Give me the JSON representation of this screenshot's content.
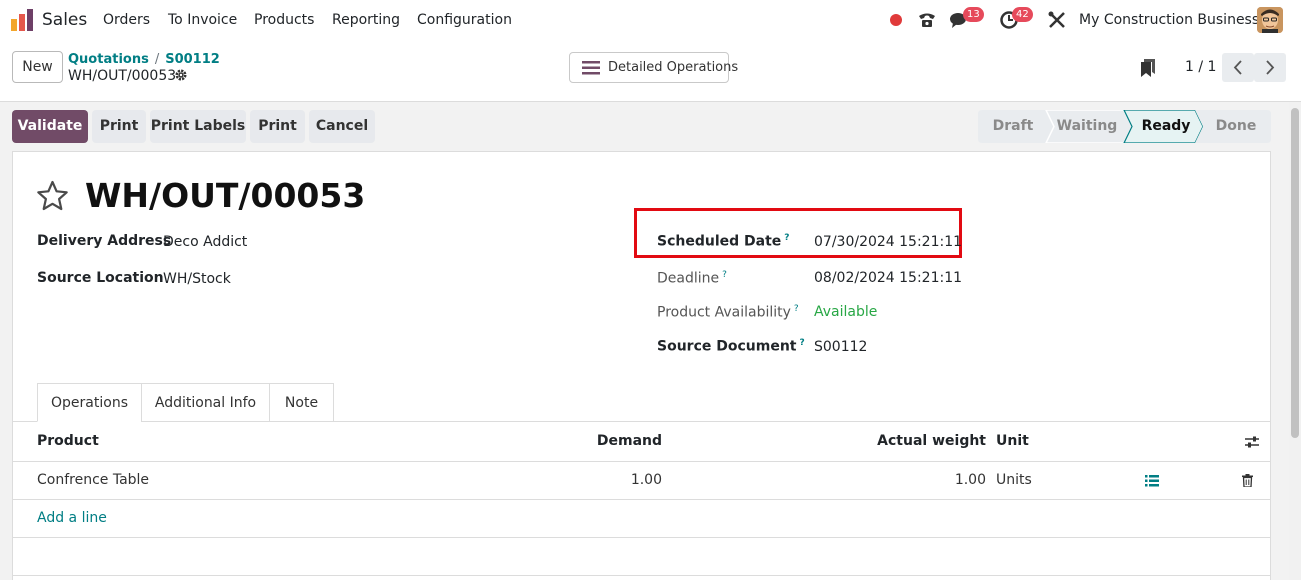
{
  "navbar": {
    "app_name": "Sales",
    "menu": [
      "Orders",
      "To Invoice",
      "Products",
      "Reporting",
      "Configuration"
    ],
    "chat_badge": "13",
    "activity_badge": "42",
    "company": "My Construction Business"
  },
  "control_panel": {
    "new_label": "New",
    "breadcrumb": [
      "Quotations",
      "S00112"
    ],
    "record_name": "WH/OUT/00053",
    "detailed_operations_label": "Detailed Operations",
    "pager": "1 / 1"
  },
  "actions": [
    "Validate",
    "Print",
    "Print Labels",
    "Print",
    "Cancel"
  ],
  "statusbar": {
    "stages": [
      "Draft",
      "Waiting",
      "Ready",
      "Done"
    ],
    "current": "Ready"
  },
  "form": {
    "title": "WH/OUT/00053",
    "delivery_address_label": "Delivery Address",
    "delivery_address": "Deco Addict",
    "source_location_label": "Source Location",
    "source_location": "WH/Stock",
    "scheduled_date_label": "Scheduled Date",
    "scheduled_date": "07/30/2024 15:21:11",
    "deadline_label": "Deadline",
    "deadline": "08/02/2024 15:21:11",
    "availability_label": "Product Availability",
    "availability": "Available",
    "source_document_label": "Source Document",
    "source_document": "S00112",
    "help_mark": "?"
  },
  "tabs": [
    "Operations",
    "Additional Info",
    "Note"
  ],
  "table": {
    "headers": {
      "product": "Product",
      "demand": "Demand",
      "actual_weight": "Actual weight",
      "unit": "Unit"
    },
    "rows": [
      {
        "product": "Confrence Table",
        "demand": "1.00",
        "actual_weight": "1.00",
        "unit": "Units"
      }
    ],
    "add_line": "Add a line"
  },
  "colors": {
    "primary": "#714b67",
    "link": "#017e84",
    "highlight_border": "#e20a12",
    "available": "#28a745"
  }
}
